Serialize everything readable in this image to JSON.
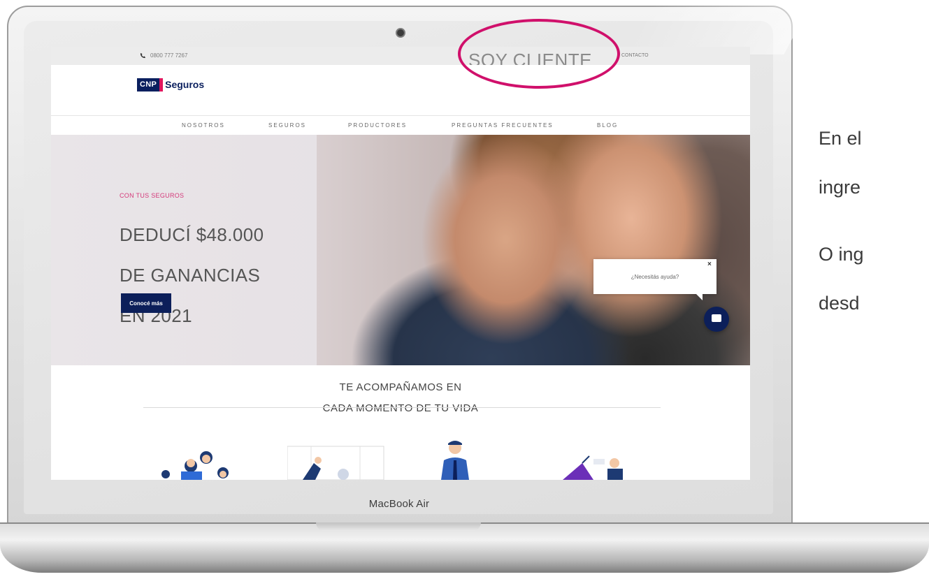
{
  "device": {
    "model_label": "MacBook Air"
  },
  "website": {
    "topbar": {
      "phone": "0800 777 7267",
      "soy_cliente": "SOY CLIENTE",
      "contacto": "CONTACTO"
    },
    "logo": {
      "cnp": "CNP",
      "seguros": "Seguros",
      "colors": {
        "navy": "#0a1f5e",
        "accent": "#e0165e"
      }
    },
    "nav": [
      "NOSOTROS",
      "SEGUROS",
      "PRODUCTORES",
      "PREGUNTAS FRECUENTES",
      "BLOG"
    ],
    "hero": {
      "kicker": "CON TUS SEGUROS",
      "title_lines": [
        "DEDUCÍ $48.000",
        "DE GANANCIAS",
        "EN 2021"
      ],
      "cta": "Conocé más"
    },
    "chat": {
      "bubble_text": "¿Necesitás ayuda?",
      "close": "×"
    },
    "section_title_lines": [
      "TE ACOMPAÑAMOS EN",
      "CADA MOMENTO DE TU VIDA"
    ]
  },
  "annotation": {
    "highlight_color": "#d0106b"
  },
  "side_text": {
    "para1": [
      "En el",
      "ingre"
    ],
    "para2": [
      "O ing",
      "desd"
    ]
  }
}
